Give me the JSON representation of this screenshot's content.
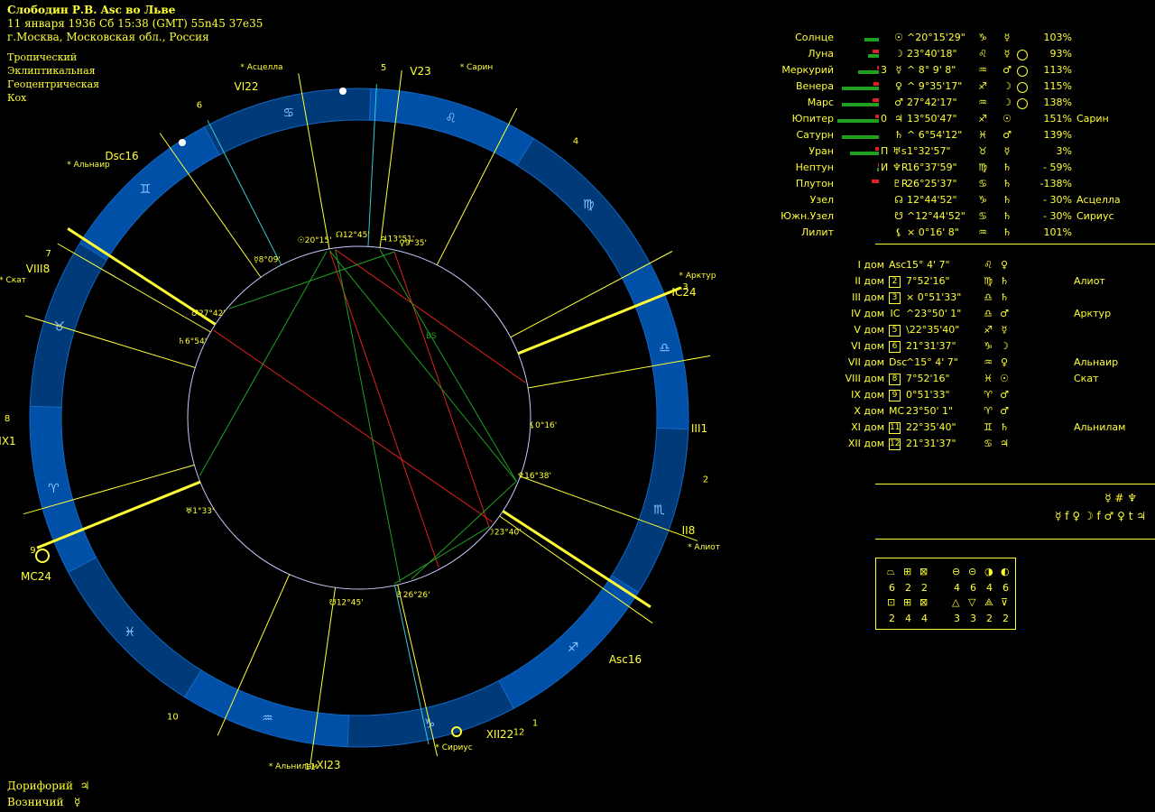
{
  "header": {
    "title": "Слободин Р.В. Asc во Льве",
    "datetime": "11 января 1936  Сб  15:38 (GMT) 55n45  37e35",
    "location": "г.Москва, Московская обл., Россия"
  },
  "settings": [
    "Тропический",
    "Эклиптикальная",
    "Геоцентрическая",
    "Кох"
  ],
  "footer": {
    "doryphory_label": "Дорифорий",
    "doryphory_glyph": "♃",
    "charioteer_label": "Возничий",
    "charioteer_glyph": "☿"
  },
  "planets": [
    {
      "name": "Солнце",
      "sym": "",
      "glyph": "☉",
      "pos": "^20°15'29\"",
      "sign": "♑",
      "ruler": "☿",
      "pct": "103%",
      "star": "",
      "green": 0.35,
      "red": 0,
      "circle": false,
      "red_mark": false
    },
    {
      "name": "Луна",
      "sym": "",
      "glyph": "☽",
      "pos": "23°40'18\"",
      "sign": "♌",
      "ruler": "☿",
      "pct": "93%",
      "star": "",
      "green": 0.25,
      "red": 0.35,
      "circle": true,
      "red_mark": true
    },
    {
      "name": "Меркурий",
      "sym": "3",
      "glyph": "☿",
      "pos": "^ 8° 9' 8\"",
      "sign": "♒",
      "ruler": "♂",
      "pct": "113%",
      "star": "",
      "green": 0.5,
      "red": 0.1,
      "circle": true,
      "red_mark": false
    },
    {
      "name": "Венера",
      "sym": "",
      "glyph": "♀",
      "pos": "^ 9°35'17\"",
      "sign": "♐",
      "ruler": "☽",
      "pct": "115%",
      "star": "",
      "green": 0.9,
      "red": 0.3,
      "circle": true,
      "red_mark": false
    },
    {
      "name": "Марс",
      "sym": "",
      "glyph": "♂",
      "pos": "27°42'17\"",
      "sign": "♒",
      "ruler": "☽",
      "pct": "138%",
      "star": "",
      "green": 0.9,
      "red": 0.35,
      "circle": true,
      "red_mark": true
    },
    {
      "name": "Юпитер",
      "sym": "0",
      "glyph": "♃",
      "pos": " 13°50'47\"",
      "sign": "♐",
      "ruler": "☉",
      "pct": "151%",
      "star": "Сарин",
      "green": 1,
      "red": 0.2,
      "circle": false,
      "red_mark": false
    },
    {
      "name": "Сатурн",
      "sym": "",
      "glyph": "♄",
      "pos": "^ 6°54'12\"",
      "sign": "♓",
      "ruler": "♂",
      "pct": "139%",
      "star": "",
      "green": 0.9,
      "red": 0,
      "circle": false,
      "red_mark": false
    },
    {
      "name": "Уран",
      "sym": "П",
      "glyph": "♅s",
      "pos": " 1°32'57\"",
      "sign": "♉",
      "ruler": "☿",
      "pct": "3%",
      "star": "",
      "green": 0.7,
      "red": 0.2,
      "circle": false,
      "red_mark": false
    },
    {
      "name": "Нептун",
      "sym": "И",
      "glyph": "♆R",
      "pos": " 16°37'59\"",
      "sign": "♍",
      "ruler": "♄",
      "pct": "- 59%",
      "star": "",
      "green": 0.05,
      "red": 0.05,
      "circle": false,
      "red_mark": false
    },
    {
      "name": "Плутон",
      "sym": "",
      "glyph": "♇R",
      "pos": "26°25'37\"",
      "sign": "♋",
      "ruler": "♄",
      "pct": "-138%",
      "star": "",
      "green": 0,
      "red": 0.4,
      "circle": false,
      "red_mark": false
    },
    {
      "name": "Узел",
      "sym": "",
      "glyph": "☊",
      "pos": " 12°44'52\"",
      "sign": "♑",
      "ruler": "♄",
      "pct": "- 30%",
      "star": "Асцелла",
      "green": 0,
      "red": 0,
      "circle": false,
      "red_mark": false
    },
    {
      "name": "Южн.Узел",
      "sym": "",
      "glyph": "☋",
      "pos": "^12°44'52\"",
      "sign": "♋",
      "ruler": "♄",
      "pct": "- 30%",
      "star": "Сириус",
      "green": 0,
      "red": 0,
      "circle": false,
      "red_mark": false
    },
    {
      "name": "Лилит",
      "sym": "",
      "glyph": "⚸",
      "pos": "× 0°16' 8\"",
      "sign": "♒",
      "ruler": "♄",
      "pct": "101%",
      "star": "",
      "green": 0,
      "red": 0,
      "circle": false,
      "red_mark": false
    }
  ],
  "houses": [
    {
      "name": "I дом",
      "key": "Asc",
      "boxed": false,
      "pos": "15° 4' 7\"",
      "sign": "♌",
      "ruler": "♀",
      "star": ""
    },
    {
      "name": "II дом",
      "key": "2",
      "boxed": true,
      "pos": " 7°52'16\"",
      "sign": "♍",
      "ruler": "♄",
      "star": "Алиот"
    },
    {
      "name": "III дом",
      "key": "3",
      "boxed": true,
      "pos": "× 0°51'33\"",
      "sign": "♎",
      "ruler": "♄",
      "star": ""
    },
    {
      "name": "IV дом",
      "key": "IC",
      "boxed": false,
      "pos": "^23°50' 1\"",
      "sign": "♎",
      "ruler": "♂",
      "star": "Арктур"
    },
    {
      "name": "V дом",
      "key": "5",
      "boxed": true,
      "pos": "\\22°35'40\"",
      "sign": "♐",
      "ruler": "☿",
      "star": ""
    },
    {
      "name": "VI дом",
      "key": "6",
      "boxed": true,
      "pos": "21°31'37\"",
      "sign": "♑",
      "ruler": "☽",
      "star": ""
    },
    {
      "name": "VII дом",
      "key": "Dsc",
      "boxed": false,
      "pos": "^15° 4' 7\"",
      "sign": "♒",
      "ruler": "♀",
      "star": "Альнаир"
    },
    {
      "name": "VIII дом",
      "key": "8",
      "boxed": true,
      "pos": " 7°52'16\"",
      "sign": "♓",
      "ruler": "☉",
      "star": "Скат"
    },
    {
      "name": "IX дом",
      "key": "9",
      "boxed": true,
      "pos": " 0°51'33\"",
      "sign": "♈",
      "ruler": "♂",
      "star": ""
    },
    {
      "name": "X дом",
      "key": "MC",
      "boxed": false,
      "pos": " 23°50' 1\"",
      "sign": "♈",
      "ruler": "♂",
      "star": ""
    },
    {
      "name": "XI дом",
      "key": "11",
      "boxed": true,
      "pos": "22°35'40\"",
      "sign": "♊",
      "ruler": "♄",
      "star": "Альнилам"
    },
    {
      "name": "XII дом",
      "key": "12",
      "boxed": true,
      "pos": " 21°31'37\"",
      "sign": "♋",
      "ruler": "♃",
      "star": ""
    }
  ],
  "misc": {
    "line1": "☿ # ♆",
    "line2": "☿ f ♀   ☽ f ♂  ♀ t ♃"
  },
  "stats": {
    "row1_values": [
      "6",
      "2",
      "2",
      "4",
      "6",
      "4",
      "6"
    ],
    "row2_values": [
      "2",
      "4",
      "4",
      "3",
      "3",
      "2",
      "2"
    ]
  },
  "chart": {
    "stars": [
      {
        "label": "Асцелла",
        "k": "ascella"
      },
      {
        "label": "Сарин",
        "k": "sarin"
      },
      {
        "label": "Альнаир",
        "k": "alnair"
      },
      {
        "label": "Скат",
        "k": "skat"
      },
      {
        "label": "Арктур",
        "k": "arktur"
      },
      {
        "label": "Алиот",
        "k": "aliot"
      },
      {
        "label": "Альнилам",
        "k": "alnilam"
      },
      {
        "label": "Сириус",
        "k": "sirius"
      }
    ],
    "house_numbers": [
      "1",
      "2",
      "3",
      "4",
      "5",
      "6",
      "7",
      "8",
      "9",
      "10",
      "11",
      "12"
    ],
    "cusp_labels": {
      "asc": "Asc",
      "asc_deg": "16",
      "mc": "MC",
      "mc_deg": "24",
      "dsc": "Dsc",
      "dsc_deg": "16",
      "ic": "IC",
      "ic_deg": "24",
      "ii": "II",
      "ii_deg": "8",
      "iii": "III",
      "iii_deg": "1",
      "v": "V",
      "v_deg": "23",
      "vi": "VI",
      "vi_deg": "22",
      "viii": "VIII",
      "viii_deg": "8",
      "ix": "IX",
      "ix_deg": "1",
      "xi": "XI",
      "xi_deg": "23",
      "xii": "XII",
      "xii_deg": "22"
    },
    "planet_labels": {
      "sun": "20°15'",
      "node": "12°45'",
      "jup": "13°51'",
      "ven": "9°35'",
      "mer": "8°09'",
      "mars": "27°42'",
      "sat": "6°54'",
      "lil": "0°16'",
      "nep": "16°38'",
      "moon": "23°40'",
      "ura": "1°33'",
      "plu": "26°26'",
      "snode": "12°45'"
    },
    "aspect_label": "BS"
  }
}
